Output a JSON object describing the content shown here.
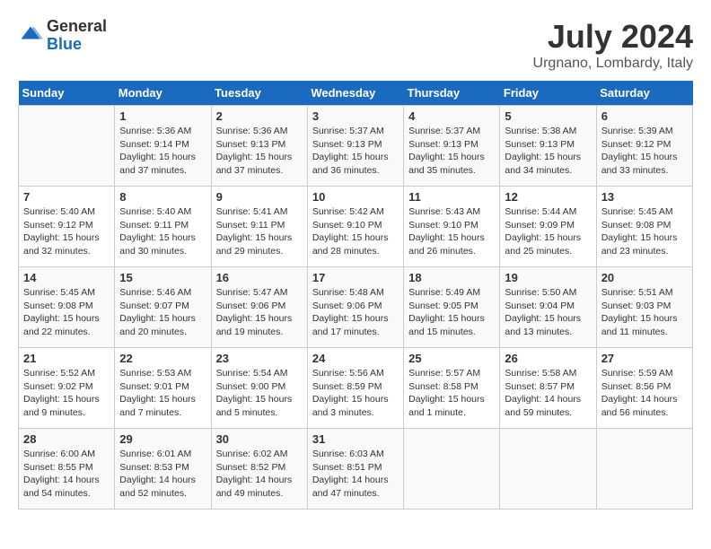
{
  "header": {
    "logo_general": "General",
    "logo_blue": "Blue",
    "month_year": "July 2024",
    "location": "Urgnano, Lombardy, Italy"
  },
  "calendar": {
    "days_of_week": [
      "Sunday",
      "Monday",
      "Tuesday",
      "Wednesday",
      "Thursday",
      "Friday",
      "Saturday"
    ],
    "weeks": [
      [
        {
          "day": "",
          "info": ""
        },
        {
          "day": "1",
          "info": "Sunrise: 5:36 AM\nSunset: 9:14 PM\nDaylight: 15 hours\nand 37 minutes."
        },
        {
          "day": "2",
          "info": "Sunrise: 5:36 AM\nSunset: 9:13 PM\nDaylight: 15 hours\nand 37 minutes."
        },
        {
          "day": "3",
          "info": "Sunrise: 5:37 AM\nSunset: 9:13 PM\nDaylight: 15 hours\nand 36 minutes."
        },
        {
          "day": "4",
          "info": "Sunrise: 5:37 AM\nSunset: 9:13 PM\nDaylight: 15 hours\nand 35 minutes."
        },
        {
          "day": "5",
          "info": "Sunrise: 5:38 AM\nSunset: 9:13 PM\nDaylight: 15 hours\nand 34 minutes."
        },
        {
          "day": "6",
          "info": "Sunrise: 5:39 AM\nSunset: 9:12 PM\nDaylight: 15 hours\nand 33 minutes."
        }
      ],
      [
        {
          "day": "7",
          "info": "Sunrise: 5:40 AM\nSunset: 9:12 PM\nDaylight: 15 hours\nand 32 minutes."
        },
        {
          "day": "8",
          "info": "Sunrise: 5:40 AM\nSunset: 9:11 PM\nDaylight: 15 hours\nand 30 minutes."
        },
        {
          "day": "9",
          "info": "Sunrise: 5:41 AM\nSunset: 9:11 PM\nDaylight: 15 hours\nand 29 minutes."
        },
        {
          "day": "10",
          "info": "Sunrise: 5:42 AM\nSunset: 9:10 PM\nDaylight: 15 hours\nand 28 minutes."
        },
        {
          "day": "11",
          "info": "Sunrise: 5:43 AM\nSunset: 9:10 PM\nDaylight: 15 hours\nand 26 minutes."
        },
        {
          "day": "12",
          "info": "Sunrise: 5:44 AM\nSunset: 9:09 PM\nDaylight: 15 hours\nand 25 minutes."
        },
        {
          "day": "13",
          "info": "Sunrise: 5:45 AM\nSunset: 9:08 PM\nDaylight: 15 hours\nand 23 minutes."
        }
      ],
      [
        {
          "day": "14",
          "info": "Sunrise: 5:45 AM\nSunset: 9:08 PM\nDaylight: 15 hours\nand 22 minutes."
        },
        {
          "day": "15",
          "info": "Sunrise: 5:46 AM\nSunset: 9:07 PM\nDaylight: 15 hours\nand 20 minutes."
        },
        {
          "day": "16",
          "info": "Sunrise: 5:47 AM\nSunset: 9:06 PM\nDaylight: 15 hours\nand 19 minutes."
        },
        {
          "day": "17",
          "info": "Sunrise: 5:48 AM\nSunset: 9:06 PM\nDaylight: 15 hours\nand 17 minutes."
        },
        {
          "day": "18",
          "info": "Sunrise: 5:49 AM\nSunset: 9:05 PM\nDaylight: 15 hours\nand 15 minutes."
        },
        {
          "day": "19",
          "info": "Sunrise: 5:50 AM\nSunset: 9:04 PM\nDaylight: 15 hours\nand 13 minutes."
        },
        {
          "day": "20",
          "info": "Sunrise: 5:51 AM\nSunset: 9:03 PM\nDaylight: 15 hours\nand 11 minutes."
        }
      ],
      [
        {
          "day": "21",
          "info": "Sunrise: 5:52 AM\nSunset: 9:02 PM\nDaylight: 15 hours\nand 9 minutes."
        },
        {
          "day": "22",
          "info": "Sunrise: 5:53 AM\nSunset: 9:01 PM\nDaylight: 15 hours\nand 7 minutes."
        },
        {
          "day": "23",
          "info": "Sunrise: 5:54 AM\nSunset: 9:00 PM\nDaylight: 15 hours\nand 5 minutes."
        },
        {
          "day": "24",
          "info": "Sunrise: 5:56 AM\nSunset: 8:59 PM\nDaylight: 15 hours\nand 3 minutes."
        },
        {
          "day": "25",
          "info": "Sunrise: 5:57 AM\nSunset: 8:58 PM\nDaylight: 15 hours\nand 1 minute."
        },
        {
          "day": "26",
          "info": "Sunrise: 5:58 AM\nSunset: 8:57 PM\nDaylight: 14 hours\nand 59 minutes."
        },
        {
          "day": "27",
          "info": "Sunrise: 5:59 AM\nSunset: 8:56 PM\nDaylight: 14 hours\nand 56 minutes."
        }
      ],
      [
        {
          "day": "28",
          "info": "Sunrise: 6:00 AM\nSunset: 8:55 PM\nDaylight: 14 hours\nand 54 minutes."
        },
        {
          "day": "29",
          "info": "Sunrise: 6:01 AM\nSunset: 8:53 PM\nDaylight: 14 hours\nand 52 minutes."
        },
        {
          "day": "30",
          "info": "Sunrise: 6:02 AM\nSunset: 8:52 PM\nDaylight: 14 hours\nand 49 minutes."
        },
        {
          "day": "31",
          "info": "Sunrise: 6:03 AM\nSunset: 8:51 PM\nDaylight: 14 hours\nand 47 minutes."
        },
        {
          "day": "",
          "info": ""
        },
        {
          "day": "",
          "info": ""
        },
        {
          "day": "",
          "info": ""
        }
      ]
    ]
  }
}
